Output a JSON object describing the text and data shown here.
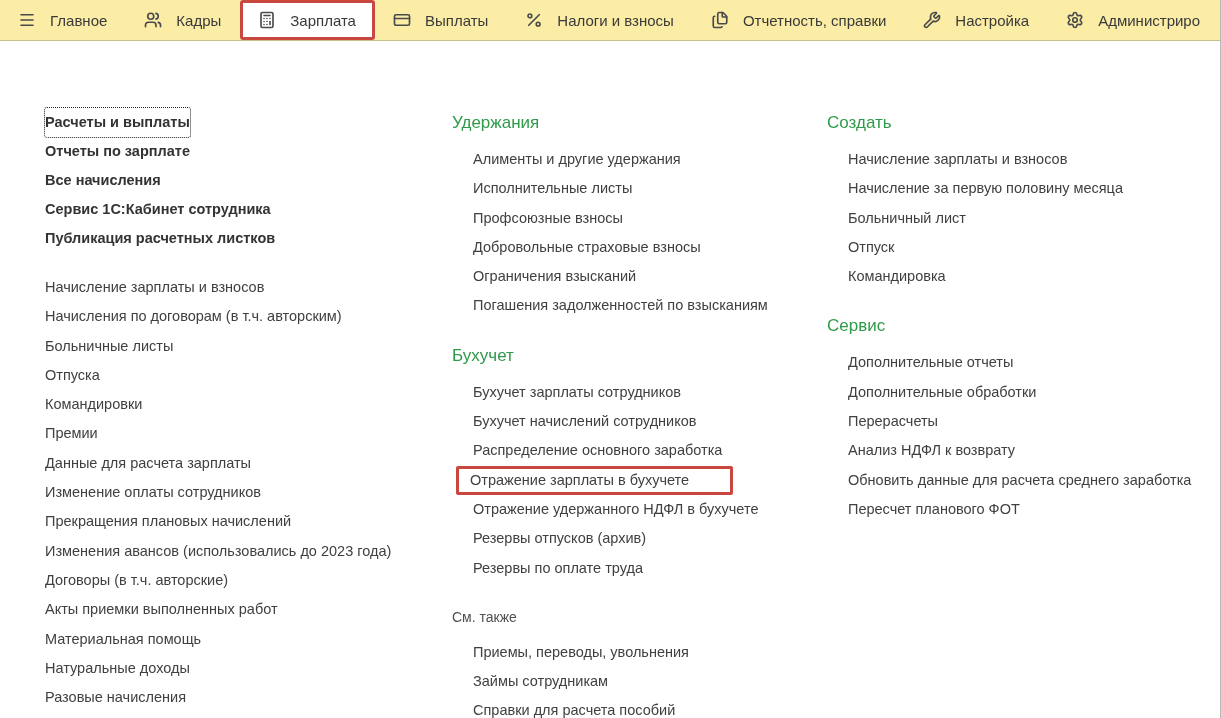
{
  "nav": [
    {
      "label": "Главное",
      "selected": false,
      "highlighted": false
    },
    {
      "label": "Кадры",
      "selected": false,
      "highlighted": false
    },
    {
      "label": "Зарплата",
      "selected": true,
      "highlighted": true
    },
    {
      "label": "Выплаты",
      "selected": false,
      "highlighted": false
    },
    {
      "label": "Налоги и взносы",
      "selected": false,
      "highlighted": false
    },
    {
      "label": "Отчетность, справки",
      "selected": false,
      "highlighted": false
    },
    {
      "label": "Настройка",
      "selected": false,
      "highlighted": false
    },
    {
      "label": "Администриро",
      "selected": false,
      "highlighted": false
    }
  ],
  "columns": [
    {
      "groups": [
        {
          "kind": "primary",
          "items": [
            {
              "label": "Расчеты и выплаты",
              "focused": true,
              "highlighted": false
            },
            {
              "label": "Отчеты по зарплате",
              "focused": false,
              "highlighted": false
            },
            {
              "label": "Все начисления",
              "focused": false,
              "highlighted": false
            },
            {
              "label": "Сервис 1С:Кабинет сотрудника",
              "focused": false,
              "highlighted": false
            },
            {
              "label": "Публикация расчетных листков",
              "focused": false,
              "highlighted": false
            }
          ]
        },
        {
          "kind": "links",
          "items": [
            {
              "label": "Начисление зарплаты и взносов",
              "focused": false,
              "highlighted": false
            },
            {
              "label": "Начисления по договорам (в т.ч. авторским)",
              "focused": false,
              "highlighted": false
            },
            {
              "label": "Больничные листы",
              "focused": false,
              "highlighted": false
            },
            {
              "label": "Отпуска",
              "focused": false,
              "highlighted": false
            },
            {
              "label": "Командировки",
              "focused": false,
              "highlighted": false
            },
            {
              "label": "Премии",
              "focused": false,
              "highlighted": false
            },
            {
              "label": "Данные для расчета зарплаты",
              "focused": false,
              "highlighted": false
            },
            {
              "label": "Изменение оплаты сотрудников",
              "focused": false,
              "highlighted": false
            },
            {
              "label": "Прекращения плановых начислений",
              "focused": false,
              "highlighted": false
            },
            {
              "label": "Изменения авансов (использовались до 2023 года)",
              "focused": false,
              "highlighted": false
            },
            {
              "label": "Договоры (в т.ч. авторские)",
              "focused": false,
              "highlighted": false
            },
            {
              "label": "Акты приемки выполненных работ",
              "focused": false,
              "highlighted": false
            },
            {
              "label": "Материальная помощь",
              "focused": false,
              "highlighted": false
            },
            {
              "label": "Натуральные доходы",
              "focused": false,
              "highlighted": false
            },
            {
              "label": "Разовые начисления",
              "focused": false,
              "highlighted": false
            }
          ]
        }
      ]
    },
    {
      "groups": [
        {
          "kind": "section",
          "title": "Удержания",
          "items": [
            {
              "label": "Алименты и другие удержания",
              "focused": false,
              "highlighted": false
            },
            {
              "label": "Исполнительные листы",
              "focused": false,
              "highlighted": false
            },
            {
              "label": "Профсоюзные взносы",
              "focused": false,
              "highlighted": false
            },
            {
              "label": "Добровольные страховые взносы",
              "focused": false,
              "highlighted": false
            },
            {
              "label": "Ограничения взысканий",
              "focused": false,
              "highlighted": false
            },
            {
              "label": "Погашения задолженностей по взысканиям",
              "focused": false,
              "highlighted": false
            }
          ]
        },
        {
          "kind": "section",
          "title": "Бухучет",
          "items": [
            {
              "label": "Бухучет зарплаты сотрудников",
              "focused": false,
              "highlighted": false
            },
            {
              "label": "Бухучет начислений сотрудников",
              "focused": false,
              "highlighted": false
            },
            {
              "label": "Распределение основного заработка",
              "focused": false,
              "highlighted": false
            },
            {
              "label": "Отражение зарплаты в бухучете",
              "focused": false,
              "highlighted": true
            },
            {
              "label": "Отражение удержанного НДФЛ в бухучете",
              "focused": false,
              "highlighted": false
            },
            {
              "label": "Резервы отпусков (архив)",
              "focused": false,
              "highlighted": false
            },
            {
              "label": "Резервы по оплате труда",
              "focused": false,
              "highlighted": false
            }
          ]
        },
        {
          "kind": "see_also",
          "title": "См. также",
          "items": [
            {
              "label": "Приемы, переводы, увольнения",
              "focused": false,
              "highlighted": false
            },
            {
              "label": "Займы сотрудникам",
              "focused": false,
              "highlighted": false
            },
            {
              "label": "Справки для расчета пособий",
              "focused": false,
              "highlighted": false
            }
          ]
        }
      ]
    },
    {
      "groups": [
        {
          "kind": "section",
          "title": "Создать",
          "items": [
            {
              "label": "Начисление зарплаты и взносов",
              "focused": false,
              "highlighted": false
            },
            {
              "label": "Начисление за первую половину месяца",
              "focused": false,
              "highlighted": false
            },
            {
              "label": "Больничный лист",
              "focused": false,
              "highlighted": false
            },
            {
              "label": "Отпуск",
              "focused": false,
              "highlighted": false
            },
            {
              "label": "Командировка",
              "focused": false,
              "highlighted": false
            }
          ]
        },
        {
          "kind": "section",
          "title": "Сервис",
          "items": [
            {
              "label": "Дополнительные отчеты",
              "focused": false,
              "highlighted": false
            },
            {
              "label": "Дополнительные обработки",
              "focused": false,
              "highlighted": false
            },
            {
              "label": "Перерасчеты",
              "focused": false,
              "highlighted": false
            },
            {
              "label": "Анализ НДФЛ к возврату",
              "focused": false,
              "highlighted": false
            },
            {
              "label": "Обновить данные для расчета среднего заработка",
              "focused": false,
              "highlighted": false
            },
            {
              "label": "Пересчет планового ФОТ",
              "focused": false,
              "highlighted": false
            }
          ]
        }
      ]
    }
  ]
}
